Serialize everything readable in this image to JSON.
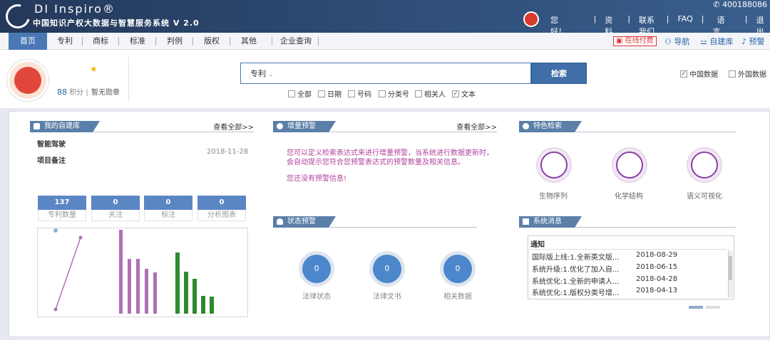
{
  "header": {
    "brand": "DI Inspiro®",
    "subtitle": "中国知识产权大数据与智慧服务系统 V 2.0",
    "phone": "400188086",
    "greeting": "您好！",
    "links": [
      "资料库",
      "联系我们",
      "FAQ",
      "语言",
      "退出"
    ]
  },
  "nav": {
    "items": [
      "首页",
      "专利",
      "商标",
      "标准",
      "判例",
      "版权",
      "其他",
      "企业查询"
    ],
    "active": "首页",
    "pay_label": "在线付费",
    "right_links": [
      "导航",
      "自建库",
      "预警"
    ]
  },
  "profile": {
    "score_value": "88",
    "score_label": "积分",
    "badge_label": "暂无勋章"
  },
  "search": {
    "type": "专利",
    "button": "检索",
    "options": [
      {
        "label": "全部",
        "checked": false
      },
      {
        "label": "日期",
        "checked": false
      },
      {
        "label": "号码",
        "checked": false
      },
      {
        "label": "分类号",
        "checked": false
      },
      {
        "label": "相关人",
        "checked": false
      },
      {
        "label": "文本",
        "checked": true
      }
    ],
    "data_sources": [
      {
        "label": "中国数据",
        "checked": true
      },
      {
        "label": "外国数据",
        "checked": false
      }
    ]
  },
  "my_library": {
    "title": "我的自建库",
    "more": "查看全部>>",
    "items": [
      "智能驾驶",
      "项目备注"
    ],
    "date": "2018-11-28",
    "stats": [
      {
        "value": "137",
        "label": "专利数量"
      },
      {
        "value": "0",
        "label": "关注"
      },
      {
        "value": "0",
        "label": "标注"
      },
      {
        "value": "0",
        "label": "分析图表"
      }
    ]
  },
  "chart_data": {
    "type": "bar",
    "series": [
      {
        "values": [
          6,
          107
        ]
      },
      {
        "values": [
          118,
          77,
          77,
          63,
          58
        ]
      },
      {
        "values": [
          86,
          59,
          49,
          25,
          24
        ]
      }
    ],
    "colors": [
      "#b070b5",
      "#2f8a2f"
    ],
    "line_color": "#b070b5"
  },
  "increment_alert": {
    "title": "增量预警",
    "more": "查看全部>>",
    "desc": "您可以定义检索表达式来进行增量预警，当系统进行数据更新时，会自动提示您符合您预警表达式的预警数量及相关信息。",
    "empty": "您还没有预警信息!"
  },
  "status_alert": {
    "title": "状态预警",
    "items": [
      {
        "value": "0",
        "label": "法律状态"
      },
      {
        "value": "0",
        "label": "法律文书"
      },
      {
        "value": "0",
        "label": "相关数据"
      }
    ]
  },
  "features": {
    "title": "特色检索",
    "items": [
      "生物序列",
      "化学结构",
      "语义可视化"
    ]
  },
  "system_messages": {
    "title": "系统消息",
    "header": "通知",
    "rows": [
      {
        "text": "国际版上线:1.全新英文版...",
        "date": "2018-08-29"
      },
      {
        "text": "系统升级:1.优化了加入自...",
        "date": "2018-06-15"
      },
      {
        "text": "系统优化:1.全新的申请人...",
        "date": "2018-04-28"
      },
      {
        "text": "系统优化:1.版权分类号增...",
        "date": "2018-04-13"
      }
    ]
  }
}
